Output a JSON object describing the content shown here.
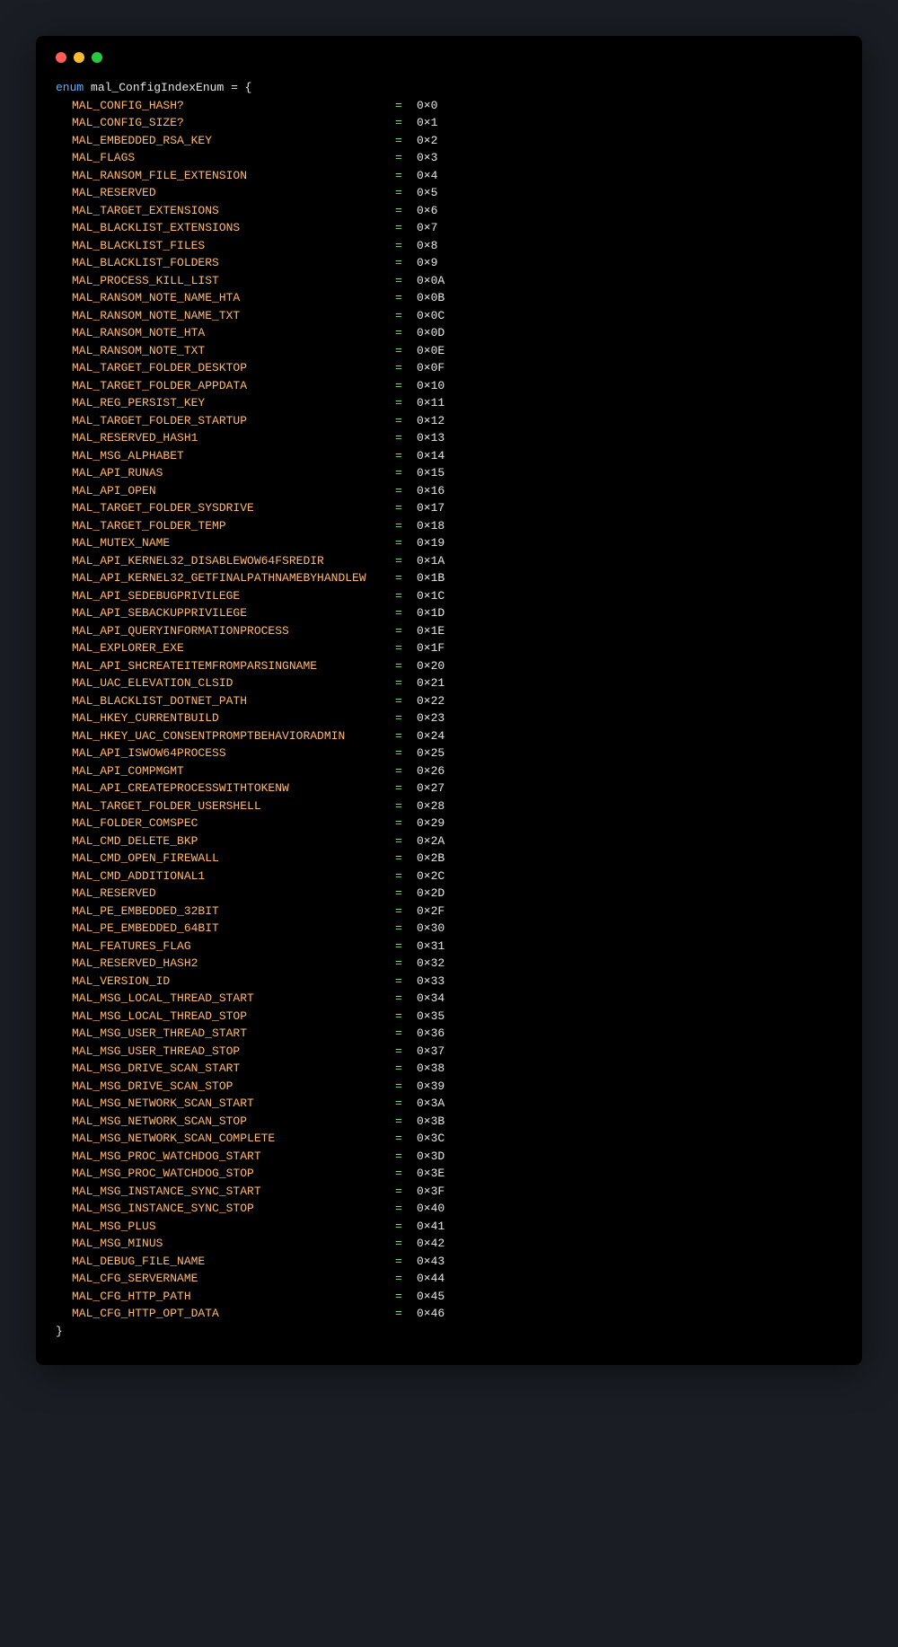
{
  "decl": {
    "keyword": "enum",
    "name": "mal_ConfigIndexEnum",
    "tail": " = {"
  },
  "close": "}",
  "eq": "=",
  "entries": [
    {
      "name": "MAL_CONFIG_HASH?",
      "val": "0×0"
    },
    {
      "name": "MAL_CONFIG_SIZE?",
      "val": "0×1"
    },
    {
      "name": "MAL_EMBEDDED_RSA_KEY",
      "val": "0×2"
    },
    {
      "name": "MAL_FLAGS",
      "val": "0×3"
    },
    {
      "name": "MAL_RANSOM_FILE_EXTENSION",
      "val": "0×4"
    },
    {
      "name": "MAL_RESERVED",
      "val": "0×5"
    },
    {
      "name": "MAL_TARGET_EXTENSIONS",
      "val": "0×6"
    },
    {
      "name": "MAL_BLACKLIST_EXTENSIONS",
      "val": "0×7"
    },
    {
      "name": "MAL_BLACKLIST_FILES",
      "val": "0×8"
    },
    {
      "name": "MAL_BLACKLIST_FOLDERS",
      "val": "0×9"
    },
    {
      "name": "MAL_PROCESS_KILL_LIST",
      "val": "0×0A"
    },
    {
      "name": "MAL_RANSOM_NOTE_NAME_HTA",
      "val": "0×0B"
    },
    {
      "name": "MAL_RANSOM_NOTE_NAME_TXT",
      "val": "0×0C"
    },
    {
      "name": "MAL_RANSOM_NOTE_HTA",
      "val": "0×0D"
    },
    {
      "name": "MAL_RANSOM_NOTE_TXT",
      "val": "0×0E"
    },
    {
      "name": "MAL_TARGET_FOLDER_DESKTOP",
      "val": "0×0F"
    },
    {
      "name": "MAL_TARGET_FOLDER_APPDATA",
      "val": "0×10"
    },
    {
      "name": "MAL_REG_PERSIST_KEY",
      "val": "0×11"
    },
    {
      "name": "MAL_TARGET_FOLDER_STARTUP",
      "val": "0×12"
    },
    {
      "name": "MAL_RESERVED_HASH1",
      "val": "0×13"
    },
    {
      "name": "MAL_MSG_ALPHABET",
      "val": "0×14"
    },
    {
      "name": "MAL_API_RUNAS",
      "val": "0×15"
    },
    {
      "name": "MAL_API_OPEN",
      "val": "0×16"
    },
    {
      "name": "MAL_TARGET_FOLDER_SYSDRIVE",
      "val": "0×17"
    },
    {
      "name": "MAL_TARGET_FOLDER_TEMP",
      "val": "0×18"
    },
    {
      "name": "MAL_MUTEX_NAME",
      "val": "0×19"
    },
    {
      "name": "MAL_API_KERNEL32_DISABLEWOW64FSREDIR",
      "val": "0×1A"
    },
    {
      "name": "MAL_API_KERNEL32_GETFINALPATHNAMEBYHANDLEW",
      "val": "0×1B"
    },
    {
      "name": "MAL_API_SEDEBUGPRIVILEGE",
      "val": "0×1C"
    },
    {
      "name": "MAL_API_SEBACKUPPRIVILEGE",
      "val": "0×1D"
    },
    {
      "name": "MAL_API_QUERYINFORMATIONPROCESS",
      "val": "0×1E"
    },
    {
      "name": "MAL_EXPLORER_EXE",
      "val": "0×1F"
    },
    {
      "name": "MAL_API_SHCREATEITEMFROMPARSINGNAME",
      "val": "0×20"
    },
    {
      "name": "MAL_UAC_ELEVATION_CLSID",
      "val": "0×21"
    },
    {
      "name": "MAL_BLACKLIST_DOTNET_PATH",
      "val": "0×22"
    },
    {
      "name": "MAL_HKEY_CURRENTBUILD",
      "val": "0×23"
    },
    {
      "name": "MAL_HKEY_UAC_CONSENTPROMPTBEHAVIORADMIN",
      "val": "0×24"
    },
    {
      "name": "MAL_API_ISWOW64PROCESS",
      "val": "0×25"
    },
    {
      "name": "MAL_API_COMPMGMT",
      "val": "0×26"
    },
    {
      "name": "MAL_API_CREATEPROCESSWITHTOKENW",
      "val": "0×27"
    },
    {
      "name": "MAL_TARGET_FOLDER_USERSHELL",
      "val": "0×28"
    },
    {
      "name": "MAL_FOLDER_COMSPEC",
      "val": "0×29"
    },
    {
      "name": "MAL_CMD_DELETE_BKP",
      "val": "0×2A"
    },
    {
      "name": "MAL_CMD_OPEN_FIREWALL",
      "val": "0×2B"
    },
    {
      "name": "MAL_CMD_ADDITIONAL1",
      "val": "0×2C"
    },
    {
      "name": "MAL_RESERVED",
      "val": "0×2D"
    },
    {
      "name": "MAL_PE_EMBEDDED_32BIT",
      "val": "0×2F"
    },
    {
      "name": "MAL_PE_EMBEDDED_64BIT",
      "val": "0×30"
    },
    {
      "name": "MAL_FEATURES_FLAG",
      "val": "0×31"
    },
    {
      "name": "MAL_RESERVED_HASH2",
      "val": "0×32"
    },
    {
      "name": "MAL_VERSION_ID",
      "val": "0×33"
    },
    {
      "name": "MAL_MSG_LOCAL_THREAD_START",
      "val": "0×34"
    },
    {
      "name": "MAL_MSG_LOCAL_THREAD_STOP",
      "val": "0×35"
    },
    {
      "name": "MAL_MSG_USER_THREAD_START",
      "val": "0×36"
    },
    {
      "name": "MAL_MSG_USER_THREAD_STOP",
      "val": "0×37"
    },
    {
      "name": "MAL_MSG_DRIVE_SCAN_START",
      "val": "0×38"
    },
    {
      "name": "MAL_MSG_DRIVE_SCAN_STOP",
      "val": "0×39"
    },
    {
      "name": "MAL_MSG_NETWORK_SCAN_START",
      "val": "0×3A"
    },
    {
      "name": "MAL_MSG_NETWORK_SCAN_STOP",
      "val": "0×3B"
    },
    {
      "name": "MAL_MSG_NETWORK_SCAN_COMPLETE",
      "val": "0×3C"
    },
    {
      "name": "MAL_MSG_PROC_WATCHDOG_START",
      "val": "0×3D"
    },
    {
      "name": "MAL_MSG_PROC_WATCHDOG_STOP",
      "val": "0×3E"
    },
    {
      "name": "MAL_MSG_INSTANCE_SYNC_START",
      "val": "0×3F"
    },
    {
      "name": "MAL_MSG_INSTANCE_SYNC_STOP",
      "val": "0×40"
    },
    {
      "name": "MAL_MSG_PLUS",
      "val": "0×41"
    },
    {
      "name": "MAL_MSG_MINUS",
      "val": "0×42"
    },
    {
      "name": "MAL_DEBUG_FILE_NAME",
      "val": "0×43"
    },
    {
      "name": "MAL_CFG_SERVERNAME",
      "val": "0×44"
    },
    {
      "name": "MAL_CFG_HTTP_PATH",
      "val": "0×45"
    },
    {
      "name": "MAL_CFG_HTTP_OPT_DATA",
      "val": "0×46"
    }
  ]
}
